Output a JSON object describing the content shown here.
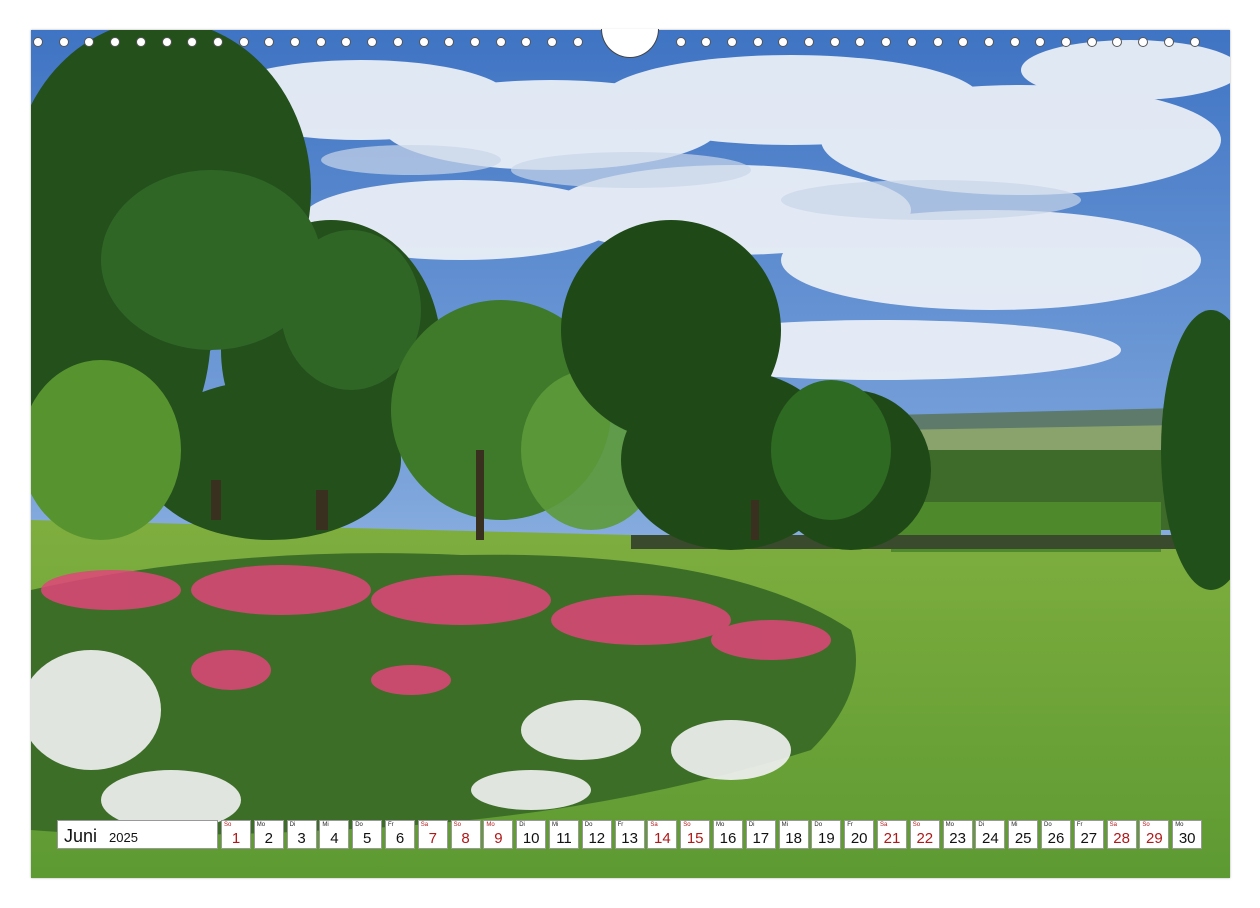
{
  "calendar": {
    "month": "Juni",
    "year": "2025",
    "days": [
      {
        "dow": "So",
        "num": "1",
        "weekend": true
      },
      {
        "dow": "Mo",
        "num": "2",
        "weekend": false
      },
      {
        "dow": "Di",
        "num": "3",
        "weekend": false
      },
      {
        "dow": "Mi",
        "num": "4",
        "weekend": false
      },
      {
        "dow": "Do",
        "num": "5",
        "weekend": false
      },
      {
        "dow": "Fr",
        "num": "6",
        "weekend": false
      },
      {
        "dow": "Sa",
        "num": "7",
        "weekend": true
      },
      {
        "dow": "So",
        "num": "8",
        "weekend": true
      },
      {
        "dow": "Mo",
        "num": "9",
        "weekend": true
      },
      {
        "dow": "Di",
        "num": "10",
        "weekend": false
      },
      {
        "dow": "Mi",
        "num": "11",
        "weekend": false
      },
      {
        "dow": "Do",
        "num": "12",
        "weekend": false
      },
      {
        "dow": "Fr",
        "num": "13",
        "weekend": false
      },
      {
        "dow": "Sa",
        "num": "14",
        "weekend": true
      },
      {
        "dow": "So",
        "num": "15",
        "weekend": true
      },
      {
        "dow": "Mo",
        "num": "16",
        "weekend": false
      },
      {
        "dow": "Di",
        "num": "17",
        "weekend": false
      },
      {
        "dow": "Mi",
        "num": "18",
        "weekend": false
      },
      {
        "dow": "Do",
        "num": "19",
        "weekend": false
      },
      {
        "dow": "Fr",
        "num": "20",
        "weekend": false
      },
      {
        "dow": "Sa",
        "num": "21",
        "weekend": true
      },
      {
        "dow": "So",
        "num": "22",
        "weekend": true
      },
      {
        "dow": "Mo",
        "num": "23",
        "weekend": false
      },
      {
        "dow": "Di",
        "num": "24",
        "weekend": false
      },
      {
        "dow": "Mi",
        "num": "25",
        "weekend": false
      },
      {
        "dow": "Do",
        "num": "26",
        "weekend": false
      },
      {
        "dow": "Fr",
        "num": "27",
        "weekend": false
      },
      {
        "dow": "Sa",
        "num": "28",
        "weekend": true
      },
      {
        "dow": "So",
        "num": "29",
        "weekend": true
      },
      {
        "dow": "Mo",
        "num": "30",
        "weekend": false
      }
    ]
  },
  "colors": {
    "weekend": "#b01818",
    "sky": "#4a7fc7",
    "lawn": "#6aa83c",
    "roses": "#e0457a"
  }
}
